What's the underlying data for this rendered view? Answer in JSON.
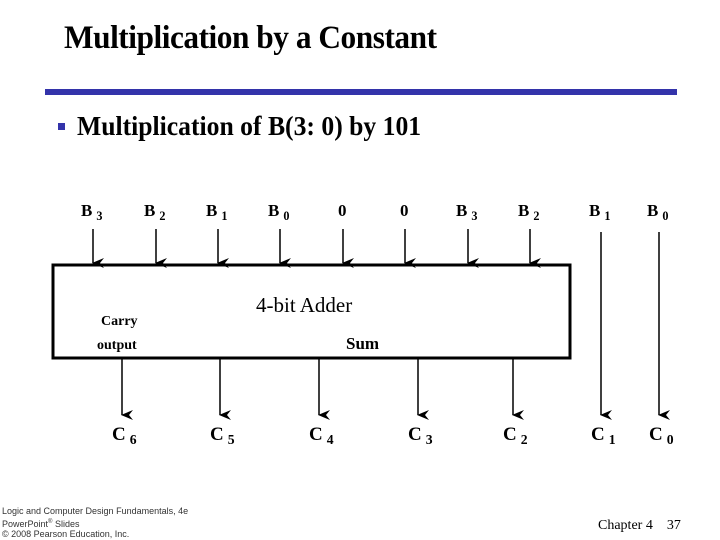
{
  "slide": {
    "title": "Multiplication by a Constant",
    "bullet": "Multiplication of B(3: 0) by 101",
    "accent_color": "#3333aa"
  },
  "diagram": {
    "block_label": "4-bit Adder",
    "carry_label_line1": "Carry",
    "carry_label_line2": "output",
    "sum_label": "Sum",
    "inputs": [
      {
        "base": "B",
        "sub": "3"
      },
      {
        "base": "B",
        "sub": "2"
      },
      {
        "base": "B",
        "sub": "1"
      },
      {
        "base": "B",
        "sub": "0"
      },
      {
        "base": "0",
        "sub": ""
      },
      {
        "base": "0",
        "sub": ""
      },
      {
        "base": "B",
        "sub": "3"
      },
      {
        "base": "B",
        "sub": "2"
      },
      {
        "base": "B",
        "sub": "1"
      },
      {
        "base": "B",
        "sub": "0"
      }
    ],
    "outputs": [
      {
        "base": "C",
        "sub": "6"
      },
      {
        "base": "C",
        "sub": "5"
      },
      {
        "base": "C",
        "sub": "4"
      },
      {
        "base": "C",
        "sub": "3"
      },
      {
        "base": "C",
        "sub": "2"
      },
      {
        "base": "C",
        "sub": "1"
      },
      {
        "base": "C",
        "sub": "0"
      }
    ]
  },
  "footer": {
    "book_line1": "Logic and Computer Design Fundamentals, 4e",
    "book_line2a": "PowerPoint",
    "book_line2_sup": "®",
    "book_line2b": " Slides",
    "book_line3": "© 2008 Pearson Education, Inc.",
    "chapter": "Chapter 4",
    "page": "37"
  }
}
